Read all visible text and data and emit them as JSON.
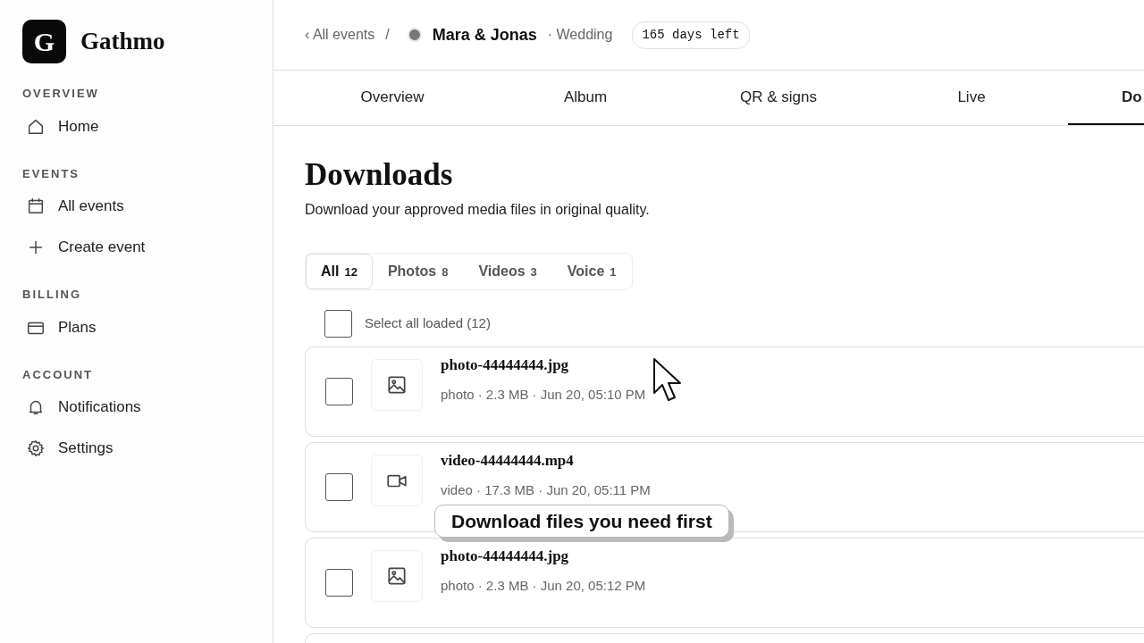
{
  "brand": {
    "logo_letter": "G",
    "name": "Gathmo"
  },
  "sidebar": {
    "sections": [
      {
        "title": "OVERVIEW",
        "items": [
          {
            "label": "Home",
            "kind": "home"
          }
        ]
      },
      {
        "title": "EVENTS",
        "items": [
          {
            "label": "All events",
            "kind": "calendar"
          },
          {
            "label": "Create event",
            "kind": "plus"
          }
        ]
      },
      {
        "title": "BILLING",
        "items": [
          {
            "label": "Plans",
            "kind": "card"
          }
        ]
      },
      {
        "title": "ACCOUNT",
        "items": [
          {
            "label": "Notifications",
            "kind": "bell"
          },
          {
            "label": "Settings",
            "kind": "gear"
          }
        ]
      }
    ]
  },
  "header": {
    "back": "‹ All events",
    "separator": "/",
    "event_name": "Mara & Jonas",
    "event_type": "· Wedding",
    "days_left": "165 days left"
  },
  "tabs": [
    {
      "label": "Overview",
      "selected": false
    },
    {
      "label": "Album",
      "selected": false
    },
    {
      "label": "QR & signs",
      "selected": false
    },
    {
      "label": "Live",
      "selected": false
    },
    {
      "label": "Do",
      "selected": true
    }
  ],
  "page": {
    "title": "Downloads",
    "subtitle": "Download your approved media files in original quality."
  },
  "filters": [
    {
      "label": "All",
      "count": "12",
      "selected": true
    },
    {
      "label": "Photos",
      "count": "8",
      "selected": false
    },
    {
      "label": "Videos",
      "count": "3",
      "selected": false
    },
    {
      "label": "Voice",
      "count": "1",
      "selected": false
    }
  ],
  "select_all": {
    "label": "Select all loaded (12)",
    "checked": false
  },
  "files": [
    {
      "kind": "photo",
      "name": "photo-44444444.jpg",
      "meta": "photo · 2.3 MB · Jun 20, 05:10 PM",
      "checked": false
    },
    {
      "kind": "video",
      "name": "video-44444444.mp4",
      "meta": "video · 17.3 MB · Jun 20, 05:11 PM",
      "checked": false
    },
    {
      "kind": "photo",
      "name": "photo-44444444.jpg",
      "meta": "photo · 2.3 MB · Jun 20, 05:12 PM",
      "checked": false
    }
  ],
  "tooltip": "Download files you need first"
}
